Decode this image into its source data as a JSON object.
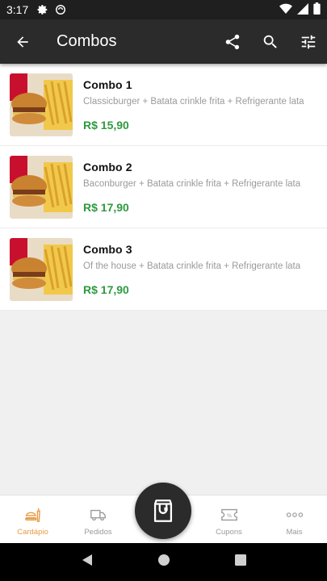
{
  "status_bar": {
    "time": "3:17"
  },
  "app_bar": {
    "title": "Combos",
    "actions": [
      "share-icon",
      "search-icon",
      "filter-icon"
    ]
  },
  "items": [
    {
      "name": "Combo 1",
      "description": "Classicburger + Batata crinkle frita + Refrigerante lata",
      "price": "R$ 15,90"
    },
    {
      "name": "Combo 2",
      "description": "Baconburger + Batata crinkle frita + Refrigerante lata",
      "price": "R$ 17,90"
    },
    {
      "name": "Combo 3",
      "description": "Of the house + Batata crinkle frita + Refrigerante lata",
      "price": "R$ 17,90"
    }
  ],
  "bottom_nav": {
    "items": [
      {
        "label": "Cardápio",
        "icon": "menu-burger-icon",
        "active": true
      },
      {
        "label": "Pedidos",
        "icon": "delivery-truck-icon",
        "active": false
      },
      {
        "label": "Cupons",
        "icon": "coupon-icon",
        "active": false
      },
      {
        "label": "Mais",
        "icon": "more-dots-icon",
        "active": false
      }
    ],
    "fab_icon": "shopping-bag-icon"
  },
  "colors": {
    "app_bar": "#2b2b2b",
    "price": "#2e9a3e",
    "active_nav": "#e79a44"
  }
}
